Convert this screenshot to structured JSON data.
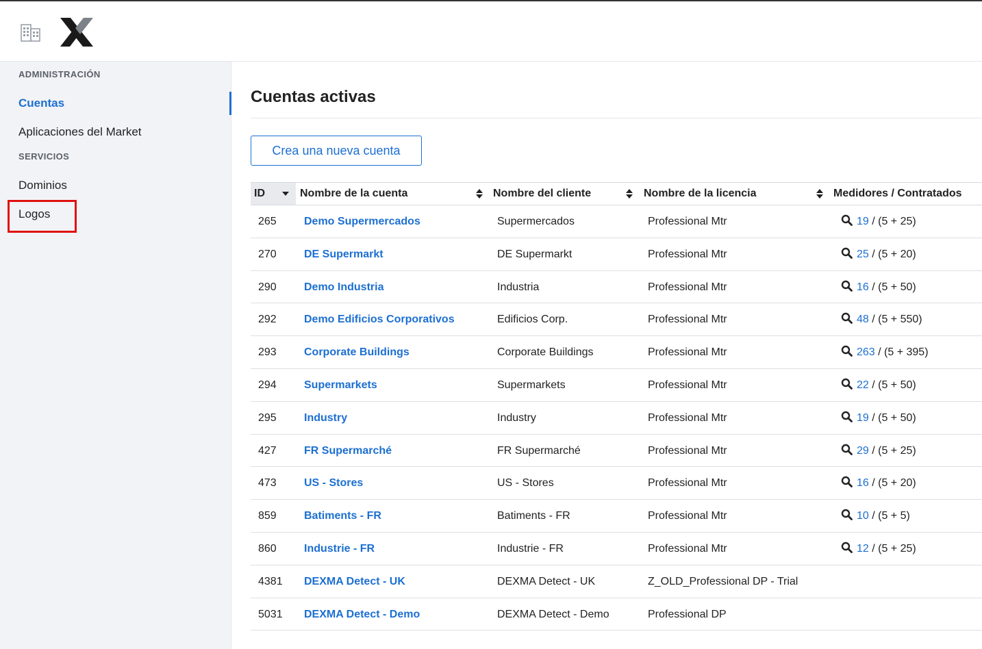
{
  "header": {
    "building_icon": "building-icon",
    "logo": "x-logo"
  },
  "sidebar": {
    "sections": [
      {
        "label": "ADMINISTRACIÓN",
        "items": [
          {
            "label": "Cuentas",
            "active": true
          },
          {
            "label": "Aplicaciones del Market"
          }
        ]
      },
      {
        "label": "SERVICIOS",
        "items": [
          {
            "label": "Dominios"
          },
          {
            "label": "Logos",
            "highlighted": true
          }
        ]
      }
    ]
  },
  "main": {
    "title": "Cuentas activas",
    "create_button": "Crea una nueva cuenta",
    "table": {
      "columns": [
        "ID",
        "Nombre de la cuenta",
        "Nombre del cliente",
        "Nombre de la licencia",
        "Medidores / Contratados"
      ],
      "rows": [
        {
          "id": "265",
          "name": "Demo Supermercados",
          "client": "Supermercados",
          "license": "Professional Mtr",
          "meters": "19",
          "contracted": " / (5 + 25)"
        },
        {
          "id": "270",
          "name": "DE Supermarkt",
          "client": "DE Supermarkt",
          "license": "Professional Mtr",
          "meters": "25",
          "contracted": " / (5 + 20)"
        },
        {
          "id": "290",
          "name": "Demo Industria",
          "client": "Industria",
          "license": "Professional Mtr",
          "meters": "16",
          "contracted": " / (5 + 50)"
        },
        {
          "id": "292",
          "name": "Demo Edificios Corporativos",
          "client": "Edificios Corp.",
          "license": "Professional Mtr",
          "meters": "48",
          "contracted": " / (5 + 550)"
        },
        {
          "id": "293",
          "name": "Corporate Buildings",
          "client": "Corporate Buildings",
          "license": "Professional Mtr",
          "meters": "263",
          "contracted": " / (5 + 395)"
        },
        {
          "id": "294",
          "name": "Supermarkets",
          "client": "Supermarkets",
          "license": "Professional Mtr",
          "meters": "22",
          "contracted": " / (5 + 50)"
        },
        {
          "id": "295",
          "name": "Industry",
          "client": "Industry",
          "license": "Professional Mtr",
          "meters": "19",
          "contracted": " / (5 + 50)"
        },
        {
          "id": "427",
          "name": "FR Supermarché",
          "client": "FR Supermarché",
          "license": "Professional Mtr",
          "meters": "29",
          "contracted": " / (5 + 25)"
        },
        {
          "id": "473",
          "name": "US - Stores",
          "client": "US - Stores",
          "license": "Professional Mtr",
          "meters": "16",
          "contracted": " / (5 + 20)"
        },
        {
          "id": "859",
          "name": "Batiments - FR",
          "client": "Batiments - FR",
          "license": "Professional Mtr",
          "meters": "10",
          "contracted": " / (5 + 5)"
        },
        {
          "id": "860",
          "name": "Industrie - FR",
          "client": "Industrie - FR",
          "license": "Professional Mtr",
          "meters": "12",
          "contracted": " / (5 + 25)"
        },
        {
          "id": "4381",
          "name": "DEXMA Detect - UK",
          "client": "DEXMA Detect - UK",
          "license": "Z_OLD_Professional DP - Trial",
          "meters": null,
          "contracted": null
        },
        {
          "id": "5031",
          "name": "DEXMA Detect - Demo",
          "client": "DEXMA Detect - Demo",
          "license": "Professional DP",
          "meters": null,
          "contracted": null
        }
      ]
    }
  },
  "colors": {
    "accent": "#1c6fd1",
    "highlight": "#e01010",
    "sidebar_bg": "#f1f3f6"
  }
}
